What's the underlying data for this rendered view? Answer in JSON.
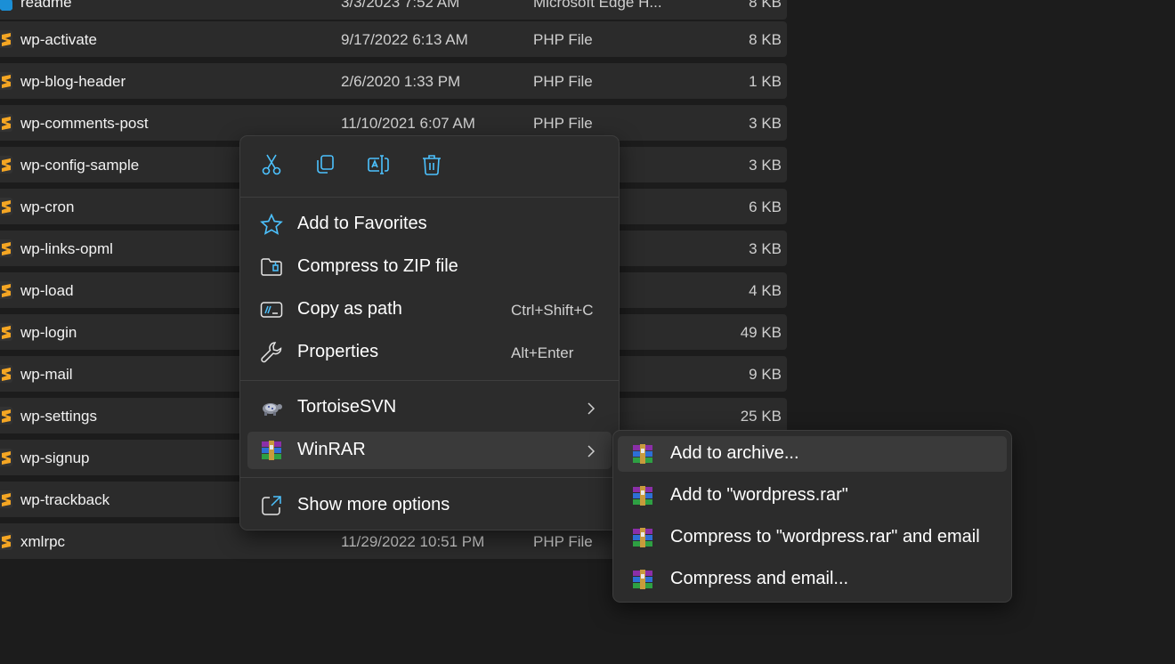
{
  "files": [
    {
      "name": "readme",
      "date": "3/3/2023 7:52 AM",
      "type": "Microsoft Edge H...",
      "size": "8 KB",
      "icon": "edge-html-icon"
    },
    {
      "name": "wp-activate",
      "date": "9/17/2022 6:13 AM",
      "type": "PHP File",
      "size": "8 KB",
      "icon": "php-file-icon"
    },
    {
      "name": "wp-blog-header",
      "date": "2/6/2020 1:33 PM",
      "type": "PHP File",
      "size": "1 KB",
      "icon": "php-file-icon"
    },
    {
      "name": "wp-comments-post",
      "date": "11/10/2021 6:07 AM",
      "type": "PHP File",
      "size": "3 KB",
      "icon": "php-file-icon"
    },
    {
      "name": "wp-config-sample",
      "date": "",
      "type": "",
      "size": "3 KB",
      "icon": "php-file-icon"
    },
    {
      "name": "wp-cron",
      "date": "",
      "type": "",
      "size": "6 KB",
      "icon": "php-file-icon"
    },
    {
      "name": "wp-links-opml",
      "date": "",
      "type": "",
      "size": "3 KB",
      "icon": "php-file-icon"
    },
    {
      "name": "wp-load",
      "date": "",
      "type": "",
      "size": "4 KB",
      "icon": "php-file-icon"
    },
    {
      "name": "wp-login",
      "date": "",
      "type": "",
      "size": "49 KB",
      "icon": "php-file-icon"
    },
    {
      "name": "wp-mail",
      "date": "",
      "type": "",
      "size": "9 KB",
      "icon": "php-file-icon"
    },
    {
      "name": "wp-settings",
      "date": "",
      "type": "",
      "size": "25 KB",
      "icon": "php-file-icon"
    },
    {
      "name": "wp-signup",
      "date": "",
      "type": "",
      "size": "",
      "icon": "php-file-icon"
    },
    {
      "name": "wp-trackback",
      "date": "",
      "type": "",
      "size": "",
      "icon": "php-file-icon"
    },
    {
      "name": "xmlrpc",
      "date": "11/29/2022 10:51 PM",
      "type": "PHP File",
      "size": "",
      "icon": "php-file-icon"
    }
  ],
  "context_menu": {
    "quick_actions": [
      {
        "name": "cut",
        "icon": "scissors-icon"
      },
      {
        "name": "copy",
        "icon": "copy-icon"
      },
      {
        "name": "rename",
        "icon": "rename-icon"
      },
      {
        "name": "delete",
        "icon": "trash-icon"
      }
    ],
    "items": [
      {
        "label": "Add to Favorites",
        "shortcut": "",
        "icon": "star-icon"
      },
      {
        "label": "Compress to ZIP file",
        "shortcut": "",
        "icon": "zip-folder-icon"
      },
      {
        "label": "Copy as path",
        "shortcut": "Ctrl+Shift+C",
        "icon": "copy-path-icon"
      },
      {
        "label": "Properties",
        "shortcut": "Alt+Enter",
        "icon": "wrench-icon"
      },
      {
        "label": "TortoiseSVN",
        "shortcut": "",
        "icon": "tortoise-icon"
      },
      {
        "label": "WinRAR",
        "shortcut": "",
        "icon": "winrar-icon"
      },
      {
        "label": "Show more options",
        "shortcut": "",
        "icon": "open-external-icon"
      }
    ]
  },
  "winrar_submenu": {
    "items": [
      {
        "label": "Add to archive...",
        "icon": "winrar-icon"
      },
      {
        "label": "Add to \"wordpress.rar\"",
        "icon": "winrar-icon"
      },
      {
        "label": "Compress to \"wordpress.rar\" and email",
        "icon": "winrar-icon"
      },
      {
        "label": "Compress and email...",
        "icon": "winrar-icon"
      }
    ]
  },
  "colors": {
    "accent": "#4cc2ff",
    "background": "#1c1c1c",
    "row": "#2b2b2b",
    "menu": "#2c2c2c",
    "php_icon": "#f5a623"
  }
}
